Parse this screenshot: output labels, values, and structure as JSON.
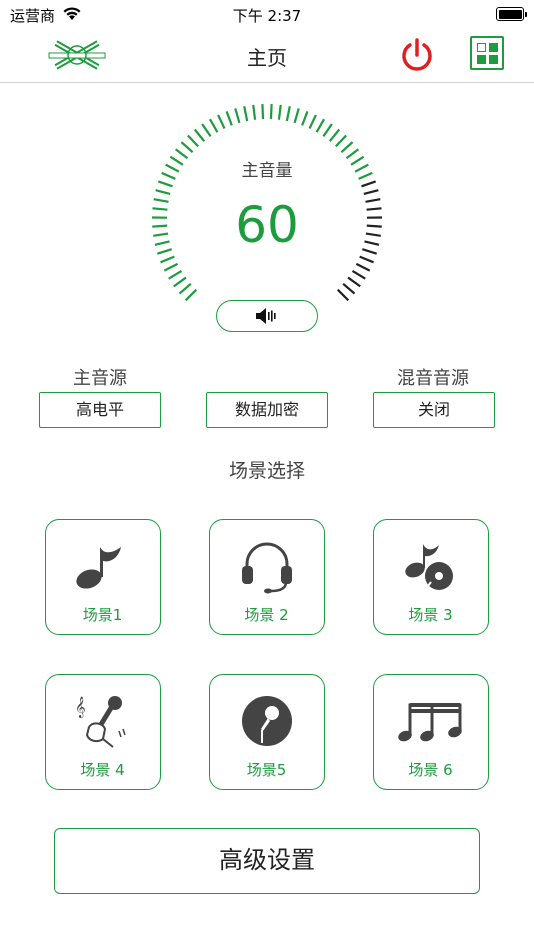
{
  "status_bar": {
    "carrier": "运营商",
    "time": "下午 2:37"
  },
  "nav": {
    "title": "主页",
    "logo_icon": "brand-logo",
    "power_icon": "power-icon",
    "grid_icon": "grid-menu-icon"
  },
  "colors": {
    "accent": "#1d9c3d",
    "power": "#e02020",
    "gauge_dark": "#222222"
  },
  "volume": {
    "label": "主音量",
    "value": "60",
    "level_fraction": 0.75,
    "mute_icon": "speaker-icon"
  },
  "sources": {
    "main_label": "主音源",
    "mix_label": "混音音源",
    "main_value": "高电平",
    "encrypt_label": "数据加密",
    "mix_value": "关闭"
  },
  "scenes": {
    "title": "场景选择",
    "items": [
      {
        "label": "场景1",
        "icon": "music-note-icon"
      },
      {
        "label": "场景 2",
        "icon": "headset-icon"
      },
      {
        "label": "场景 3",
        "icon": "music-disc-icon"
      },
      {
        "label": "场景 4",
        "icon": "hand-microphone-icon"
      },
      {
        "label": "场景5",
        "icon": "microphone-circle-icon"
      },
      {
        "label": "场景 6",
        "icon": "music-notes-icon"
      }
    ]
  },
  "advanced_label": "高级设置"
}
